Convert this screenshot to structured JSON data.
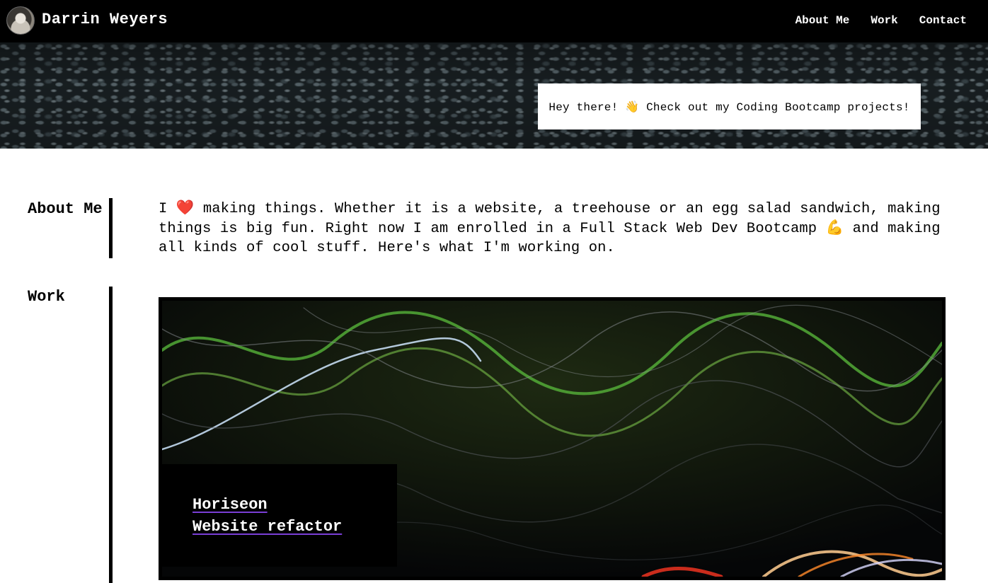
{
  "header": {
    "brand": "Darrin Weyers",
    "nav": [
      "About Me",
      "Work",
      "Contact"
    ]
  },
  "hero": {
    "message": "Hey there! 👋 Check out my Coding Bootcamp projects!"
  },
  "about": {
    "heading": "About Me",
    "text": "I ❤️ making things. Whether it is a website, a treehouse or an egg salad sandwich, making things is big fun. Right now I am enrolled in a Full Stack Web Dev Bootcamp 💪 and making all kinds of cool stuff. Here's what I'm working on."
  },
  "work": {
    "heading": "Work",
    "project": {
      "title": "Horiseon",
      "subtitle": "Website refactor"
    }
  },
  "colors": {
    "header_bg": "#000000",
    "link_underline": "#7a3ed6",
    "rule": "#000000"
  }
}
